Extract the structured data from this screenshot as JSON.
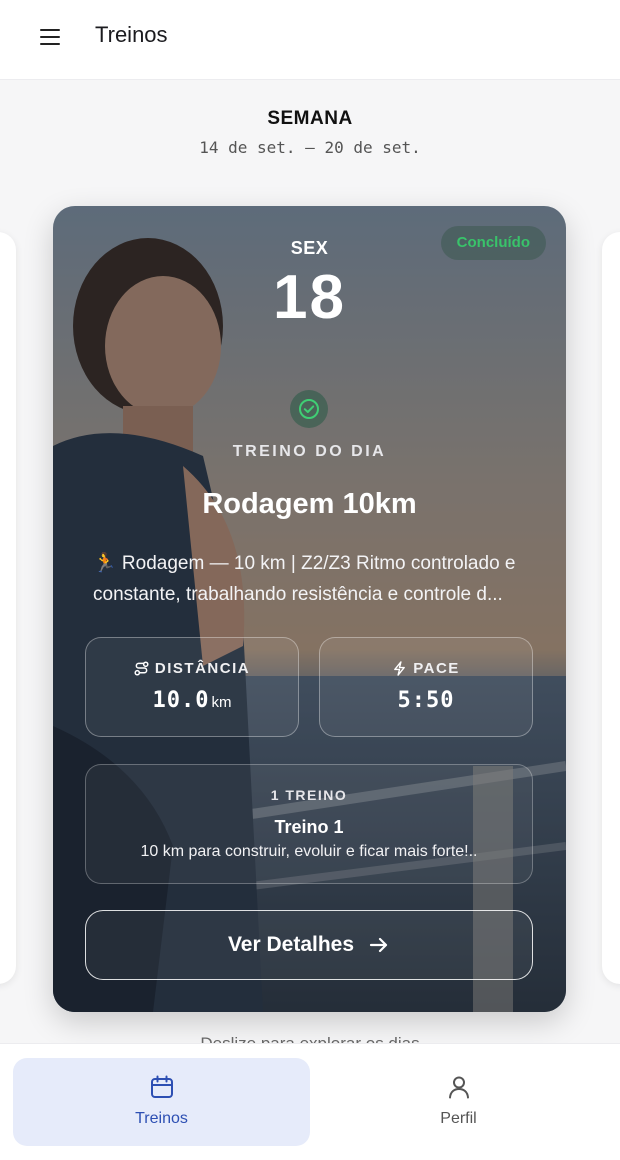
{
  "header": {
    "title": "Treinos",
    "menu_icon": "hamburger-menu-icon"
  },
  "week": {
    "label": "SEMANA",
    "range": "14 de set. — 20 de set."
  },
  "card": {
    "status": "Concluído",
    "day_name": "SEX",
    "day_number": "18",
    "section_label": "TREINO DO DIA",
    "title": "Rodagem 10km",
    "description": "🏃 Rodagem — 10 km | Z2/Z3 Ritmo controlado e constante, trabalhando resistência e controle d...",
    "stats": {
      "distance": {
        "label": "DISTÂNCIA",
        "value": "10.0",
        "unit": "km"
      },
      "pace": {
        "label": "PACE",
        "value": "5:50"
      }
    },
    "plan": {
      "count": "1 TREINO",
      "name": "Treino 1",
      "description": "10 km para construir, evoluir e ficar mais forte!.."
    },
    "button": {
      "label": "Ver Detalhes"
    }
  },
  "swipe_hint": "Deslize para explorar os dias",
  "bottom_nav": [
    {
      "label": "Treinos",
      "icon": "calendar-icon",
      "active": true
    },
    {
      "label": "Perfil",
      "icon": "user-icon",
      "active": false
    }
  ],
  "colors": {
    "accent": "#2d4fb3",
    "status_green": "#39c36a",
    "nav_active_bg": "#e6ebfa"
  }
}
